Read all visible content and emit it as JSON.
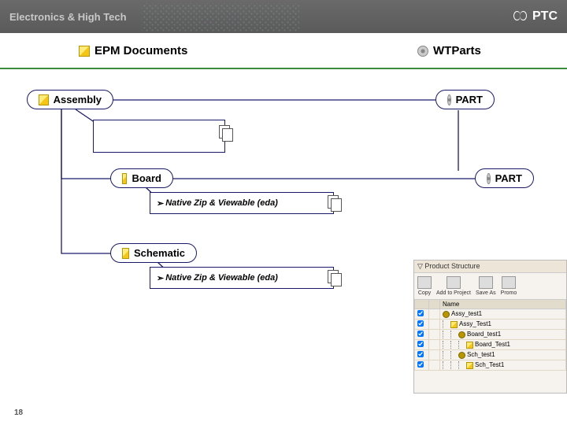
{
  "header": {
    "title": "Electronics & High Tech",
    "logo_text": "PTC"
  },
  "sections": {
    "epm": {
      "label": "EPM Documents"
    },
    "wtparts": {
      "label": "WTParts"
    }
  },
  "nodes": {
    "assembly": {
      "label": "Assembly"
    },
    "board": {
      "label": "Board",
      "attach": "Native Zip & Viewable (eda)"
    },
    "schematic": {
      "label": "Schematic",
      "attach": "Native Zip & Viewable (eda)"
    },
    "part1": {
      "label": "PART"
    },
    "part2": {
      "label": "PART"
    }
  },
  "inset": {
    "title": "Product Structure",
    "tools": [
      "Copy",
      "Add to Project",
      "Save As",
      "Promo"
    ],
    "col_name": "Name",
    "rows": [
      {
        "type": "gear",
        "label": "Assy_test1",
        "indent": 0
      },
      {
        "type": "sq",
        "label": "Assy_Test1",
        "indent": 1
      },
      {
        "type": "gear",
        "label": "Board_test1",
        "indent": 2
      },
      {
        "type": "sq",
        "label": "Board_Test1",
        "indent": 3
      },
      {
        "type": "gear",
        "label": "Sch_test1",
        "indent": 2
      },
      {
        "type": "sq",
        "label": "Sch_Test1",
        "indent": 3
      }
    ]
  },
  "slide_number": "18"
}
